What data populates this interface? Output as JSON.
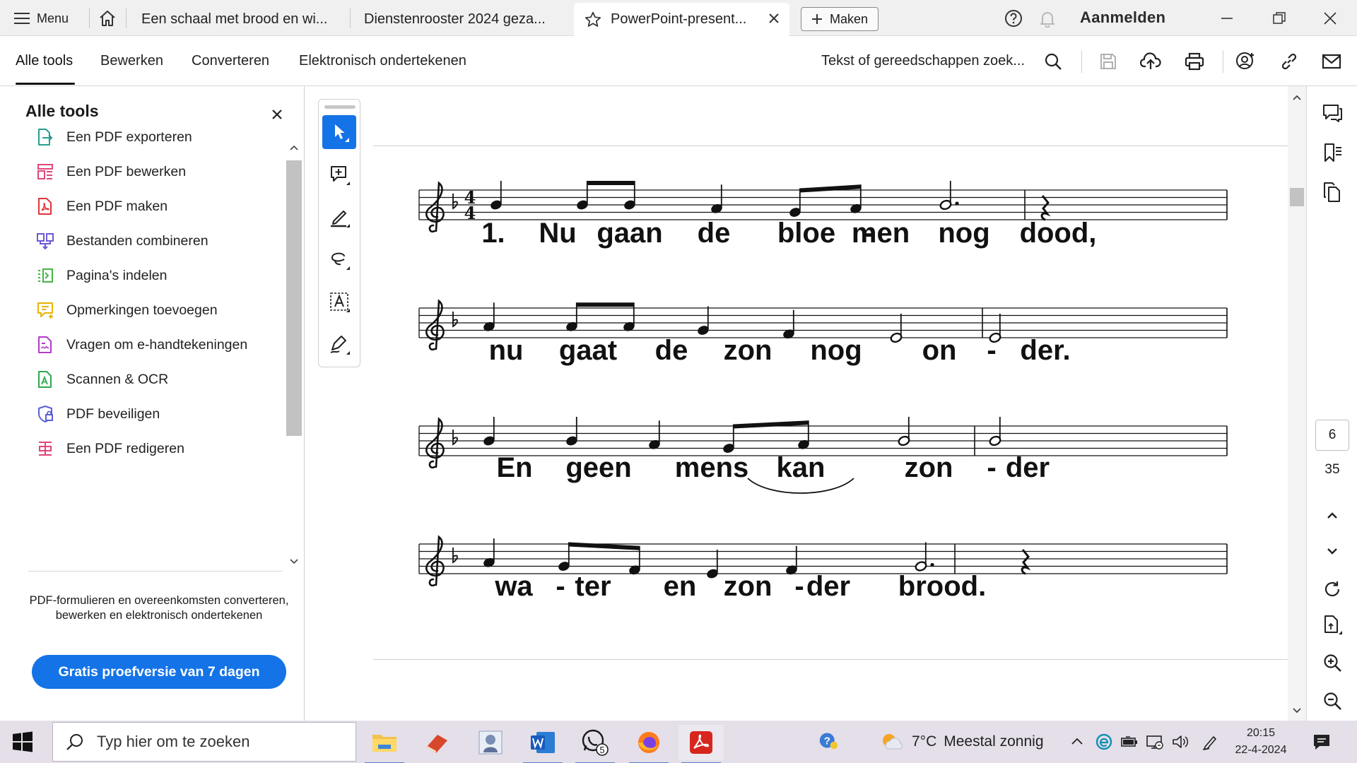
{
  "titlebar": {
    "menu_label": "Menu",
    "tabs": [
      {
        "label": "Een schaal met brood en wi..."
      },
      {
        "label": "Dienstenrooster 2024 geza..."
      },
      {
        "label": "PowerPoint-present..."
      }
    ],
    "create_label": "Maken",
    "signin_label": "Aanmelden"
  },
  "menubar": {
    "tabs": [
      {
        "label": "Alle tools"
      },
      {
        "label": "Bewerken"
      },
      {
        "label": "Converteren"
      },
      {
        "label": "Elektronisch ondertekenen"
      }
    ],
    "search_placeholder": "Tekst of gereedschappen zoek..."
  },
  "leftpanel": {
    "title": "Alle tools",
    "tools": [
      {
        "label": "Een PDF exporteren",
        "icon": "export-pdf-icon",
        "color": "#2a9d8f"
      },
      {
        "label": "Een PDF bewerken",
        "icon": "edit-pdf-icon",
        "color": "#e0457b"
      },
      {
        "label": "Een PDF maken",
        "icon": "create-pdf-icon",
        "color": "#e0343b"
      },
      {
        "label": "Bestanden combineren",
        "icon": "combine-files-icon",
        "color": "#6f58d6"
      },
      {
        "label": "Pagina's indelen",
        "icon": "organize-pages-icon",
        "color": "#45b345"
      },
      {
        "label": "Opmerkingen toevoegen",
        "icon": "add-comment-icon",
        "color": "#e6b400"
      },
      {
        "label": "Vragen om e-handtekeningen",
        "icon": "request-signature-icon",
        "color": "#b13cc8"
      },
      {
        "label": "Scannen & OCR",
        "icon": "scan-ocr-icon",
        "color": "#2ea84f"
      },
      {
        "label": "PDF beveiligen",
        "icon": "protect-pdf-icon",
        "color": "#5b5fd6"
      },
      {
        "label": "Een PDF redigeren",
        "icon": "redact-pdf-icon",
        "color": "#e0457b"
      }
    ],
    "promo_text": "PDF-formulieren en overeenkomsten converteren, bewerken en elektronisch ondertekenen",
    "trial_button": "Gratis proefversie van 7 dagen",
    "accent": "#1473e6"
  },
  "document": {
    "verse_number": "1.",
    "lyrics": [
      [
        "Nu",
        "gaan",
        "de",
        "bloe",
        "-",
        "men",
        "nog",
        "dood,"
      ],
      [
        "nu",
        "gaat",
        "de",
        "zon",
        "nog",
        "on",
        "-",
        "der."
      ],
      [
        "En",
        "geen",
        "mens",
        "kan",
        "zon",
        "-",
        "der"
      ],
      [
        "wa",
        "-",
        "ter",
        "en",
        "zon",
        "-",
        "der",
        "brood."
      ]
    ],
    "time_signature": [
      "4",
      "4"
    ]
  },
  "rightrail": {
    "current_page": "6",
    "total_pages": "35"
  },
  "taskbar": {
    "search_placeholder": "Typ hier om te zoeken",
    "whatsapp_badge": "5",
    "weather_temp": "7°C",
    "weather_text": "Meestal zonnig",
    "time": "20:15",
    "date": "22-4-2024"
  }
}
